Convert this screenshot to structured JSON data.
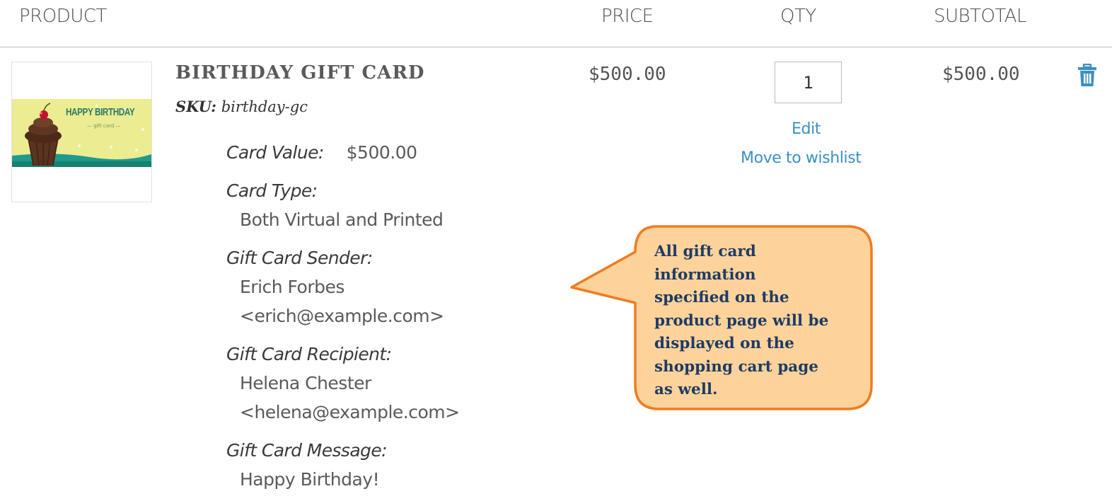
{
  "table_header": {
    "product": "PRODUCT",
    "price": "PRICE",
    "qty": "QTY",
    "subtotal": "SUBTOTAL"
  },
  "item": {
    "image_text": {
      "line1": "HAPPY BIRTHDAY",
      "line2": "— gift card —"
    },
    "name": "BIRTHDAY GIFT CARD",
    "sku_label": "SKU:",
    "sku_value": "birthday-gc",
    "options": [
      {
        "label": "Card Value:",
        "value": "$500.00"
      },
      {
        "label": "Card Type:",
        "values": [
          "Both Virtual and Printed"
        ]
      },
      {
        "label": "Gift Card Sender:",
        "values": [
          "Erich Forbes",
          "<erich@example.com>"
        ]
      },
      {
        "label": "Gift Card Recipient:",
        "values": [
          "Helena Chester",
          "<helena@example.com>"
        ]
      },
      {
        "label": "Gift Card Message:",
        "values": [
          "Happy Birthday!"
        ]
      }
    ],
    "price": "$500.00",
    "qty": "1",
    "subtotal": "$500.00",
    "edit_label": "Edit",
    "wishlist_label": "Move to wishlist",
    "delete_icon": "trash-icon"
  },
  "callout": {
    "lines": [
      "All gift card",
      "information",
      "specified on the",
      "product page will be",
      "displayed on the",
      "shopping cart page",
      "as well."
    ],
    "fill": "#fdd39b",
    "border": "#f07c1e"
  },
  "colors": {
    "link": "#3b8fc4",
    "icon": "#3b8fc4",
    "header_rule": "#bdbdbd"
  }
}
